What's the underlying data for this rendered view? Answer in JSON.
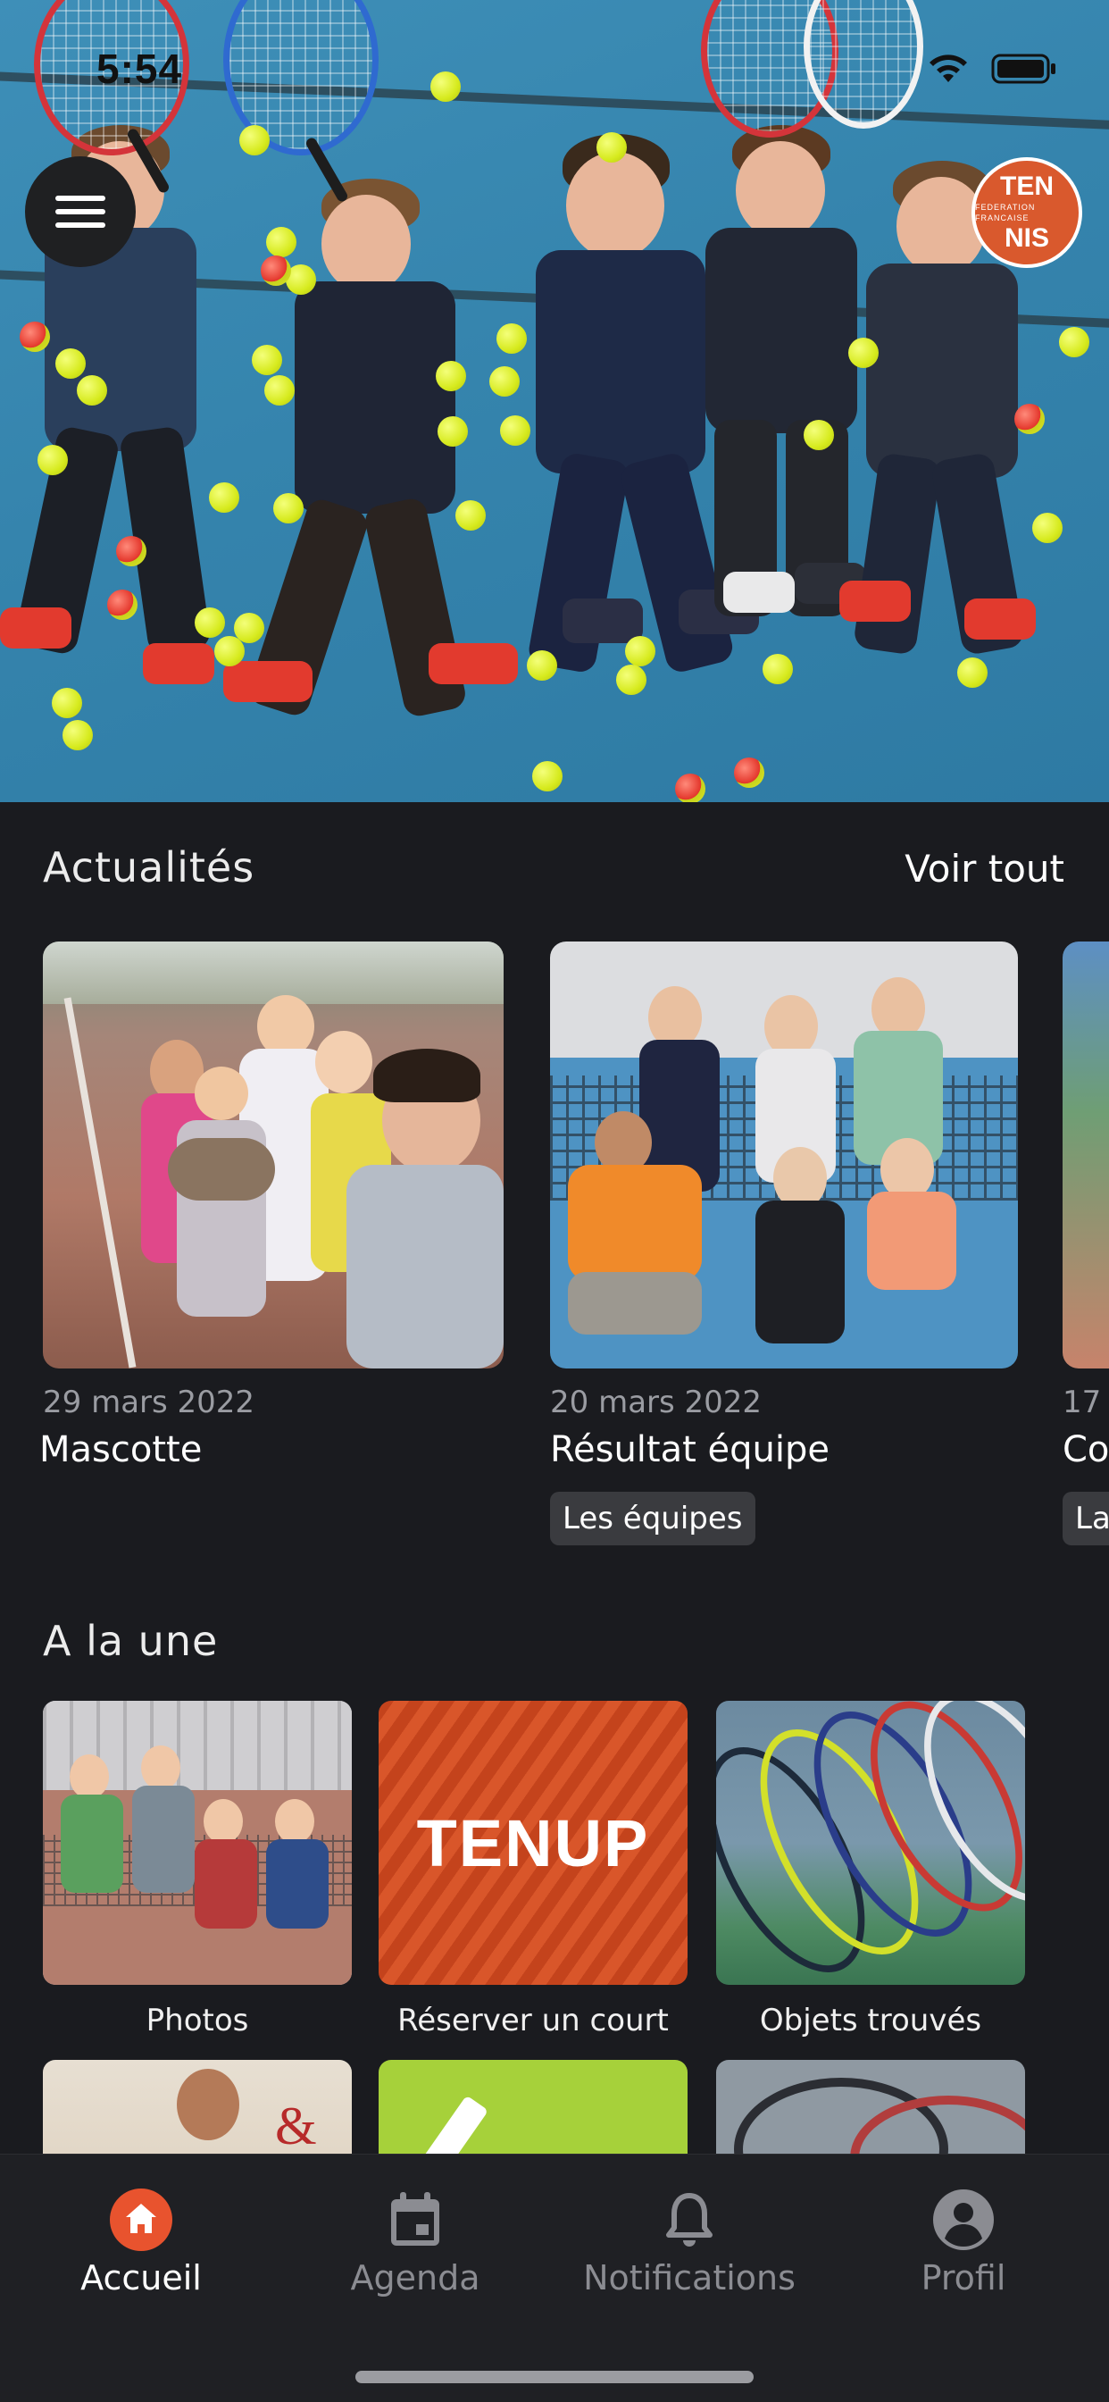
{
  "status_bar": {
    "time": "5:54"
  },
  "header": {
    "menu_icon": "hamburger-menu-icon",
    "club_logo_text_top": "TEN",
    "club_logo_text_mid": "FEDERATION FRANCAISE",
    "club_logo_text_bottom": "NIS"
  },
  "news": {
    "section_title": "Actualités",
    "see_all_label": "Voir tout",
    "items": [
      {
        "date": "29 mars 2022",
        "title": "Mascotte",
        "tag": ""
      },
      {
        "date": "20 mars 2022",
        "title": "Résultat équipe",
        "tag": "Les équipes"
      },
      {
        "date": "17",
        "title": "Co",
        "tag": "La"
      }
    ]
  },
  "featured": {
    "section_title": "A la une",
    "tiles": [
      {
        "label": "Photos"
      },
      {
        "label": "Réserver un court",
        "logo_text": "TENUP"
      },
      {
        "label": "Objets trouvés"
      }
    ]
  },
  "tabbar": {
    "items": [
      {
        "label": "Accueil",
        "icon": "home-icon",
        "active": true
      },
      {
        "label": "Agenda",
        "icon": "calendar-icon",
        "active": false
      },
      {
        "label": "Notifications",
        "icon": "bell-icon",
        "active": false
      },
      {
        "label": "Profil",
        "icon": "profile-icon",
        "active": false
      }
    ]
  },
  "colors": {
    "accent": "#e8532e",
    "background": "#1a1b1f",
    "tabbar": "#1f2024"
  }
}
